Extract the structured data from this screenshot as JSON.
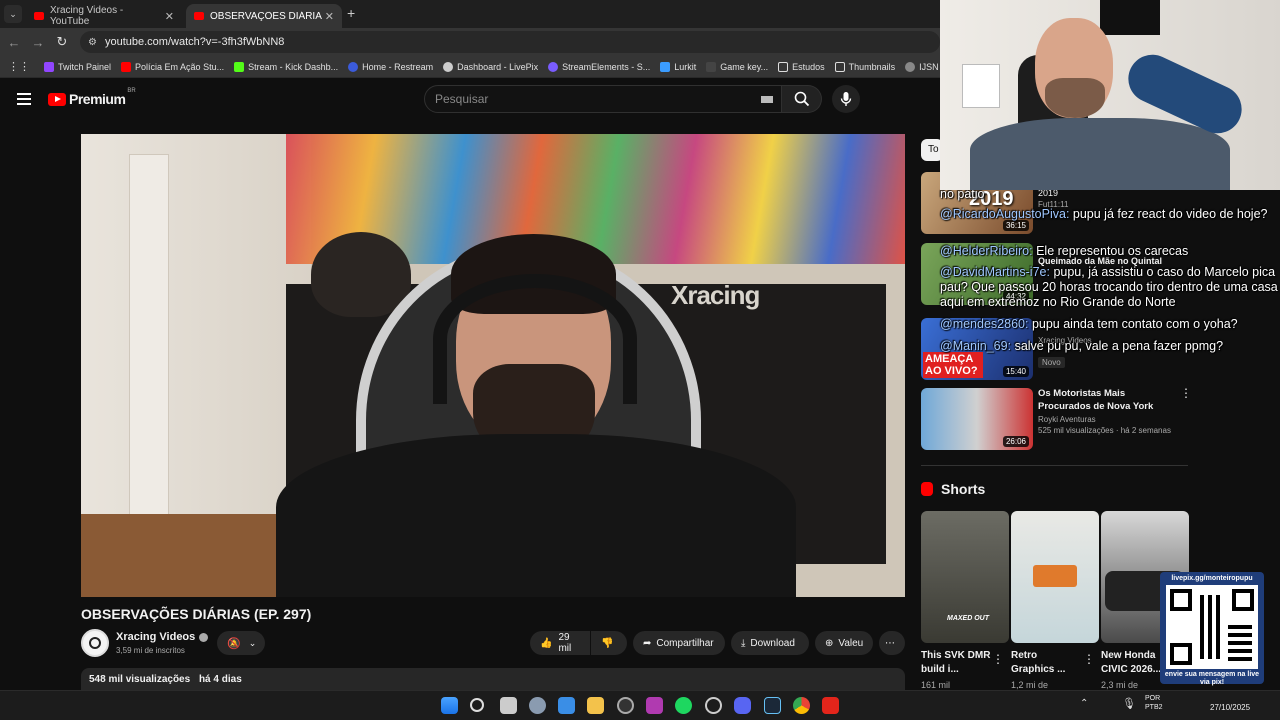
{
  "browser": {
    "tabs": [
      {
        "title": "Xracing Videos - YouTube",
        "active": false
      },
      {
        "title": "OBSERVAÇÕES DIÁRIAS (EP. 29",
        "active": true
      }
    ],
    "new_tab": "+",
    "url": "youtube.com/watch?v=-3fh3fWbNN8",
    "bookmarks": [
      "Twitch Painel",
      "Polícia Em Ação Stu...",
      "Stream - Kick Dashb...",
      "Home - Restream",
      "Dashboard - LivePix",
      "StreamElements - S...",
      "Lurkit",
      "Game key...",
      "Estudos",
      "Thumbnails",
      "IJSN - Instituto Jone..."
    ]
  },
  "youtube": {
    "logo": "Premium",
    "logo_region": "BR",
    "search_placeholder": "Pesquisar",
    "video": {
      "title": "OBSERVAÇÕES DIÁRIAS (EP. 297)",
      "channel": "Xracing Videos",
      "subscribers": "3,59 mi de inscritos",
      "likes": "29 mil",
      "share": "Compartilhar",
      "download": "Download",
      "thanks": "Valeu",
      "views": "548 mil visualizações",
      "age": "há 4 dias",
      "scene_text": "Xracing"
    },
    "chip_partial": "To",
    "recommendations": [
      {
        "title": "2019",
        "sub": "Fut11:11",
        "views": "",
        "duration": "36:15",
        "thumb_text": "2019"
      },
      {
        "title": "Queimado da Mãe no Quintal",
        "sub": "",
        "duration": "44:32",
        "thumb_text": ""
      },
      {
        "title": "",
        "channel": "Xracing Videos",
        "badge": "Novo",
        "duration": "15:40",
        "thumb_text": "AMEAÇA AO VIVO?"
      },
      {
        "title": "Os Motoristas Mais Procurados de Nova York",
        "channel": "Royki Aventuras",
        "meta": "525 mil visualizações · há 2 semanas",
        "duration": "26:06"
      }
    ],
    "shorts_header": "Shorts",
    "shorts": [
      {
        "title": "This SVK DMR build i...",
        "views": "161 mil",
        "overlay": "MAXED OUT"
      },
      {
        "title": "Retro Graphics ...",
        "views": "1,2 mi de"
      },
      {
        "title": "New Honda CIVIC 2026...",
        "views": "2,3 mi de"
      }
    ]
  },
  "chat": [
    {
      "user": "",
      "text": "no pátio"
    },
    {
      "user": "@RicardoAugustoPiva:",
      "text": "pupu já fez react do video de hoje?"
    },
    {
      "user": "@HelderRibeiro:",
      "text": "Ele representou os carecas"
    },
    {
      "user": "@DavidMartins-i7e:",
      "text": "pupu, já assistiu o caso do Marcelo pica pau? Que passou 20 horas trocando tiro dentro de uma casa aqui em extremoz no Rio Grande do Norte"
    },
    {
      "user": "@mendes2860:",
      "text": "pupu ainda tem contato com o yoha?"
    },
    {
      "user": "@Manin_69:",
      "text": "salve pu pu, vale a pena fazer ppmg?"
    }
  ],
  "qr": {
    "url": "livepix.gg/monteiropupu",
    "caption": "envie sua mensagem na live via pix!"
  },
  "taskbar": {
    "lang": "POR",
    "layout": "PTB2",
    "date": "27/10/2025"
  },
  "colors": {
    "brand_red": "#ff0000",
    "background": "#0f0f0f",
    "chip": "#272727"
  }
}
